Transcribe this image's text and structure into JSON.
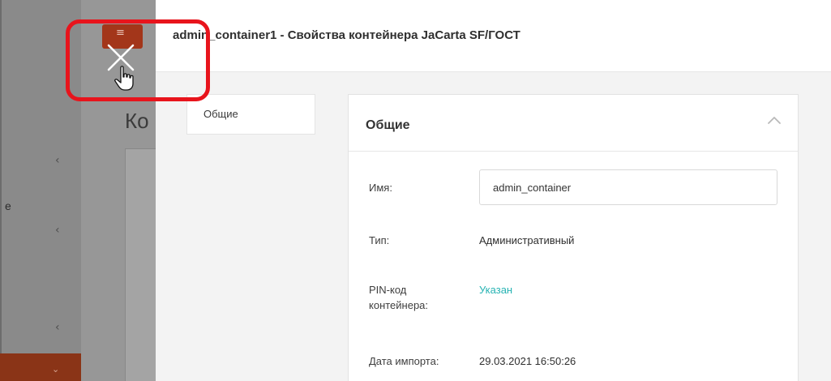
{
  "background": {
    "page_title_fragment": "Ко",
    "sidebar_text_fragment": "е"
  },
  "panel": {
    "title": "admin_container1 - Свойства контейнера JaCarta SF/ГОСТ",
    "nav_tabs": [
      {
        "label": "Общие"
      }
    ],
    "section": {
      "title": "Общие",
      "fields": {
        "name": {
          "label": "Имя:",
          "value": "admin_container"
        },
        "type": {
          "label": "Тип:",
          "value": "Административный"
        },
        "pin": {
          "label": "PIN-код контейнера:",
          "value": "Указан"
        },
        "import_date": {
          "label": "Дата импорта:",
          "value": "29.03.2021 16:50:26"
        }
      }
    }
  },
  "colors": {
    "highlight": "#e8141c",
    "accent_link": "#27b3b3",
    "brand_orange": "#a3361a"
  },
  "icons": [
    "menu-icon",
    "close-icon",
    "hand-cursor-icon",
    "chevron-left-icon",
    "chevron-down-icon",
    "chevron-up-icon"
  ]
}
